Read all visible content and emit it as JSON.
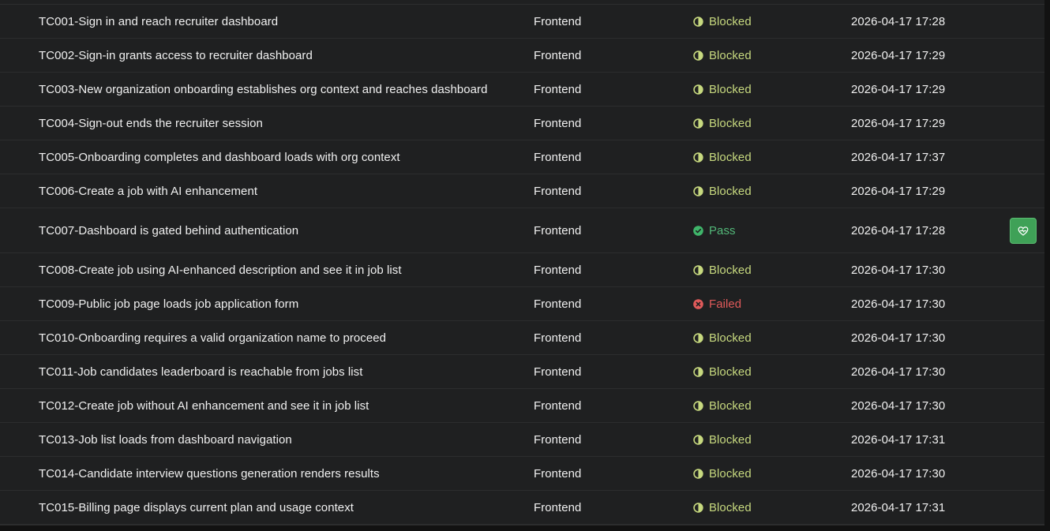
{
  "colors": {
    "background": "#1f2021",
    "blocked": "#c7d97f",
    "pass": "#53b879",
    "failed": "#e05a5a",
    "action_button": "#3fa157"
  },
  "rows": [
    {
      "name": "TC001-Sign in and reach recruiter dashboard",
      "type": "Frontend",
      "status": "Blocked",
      "status_icon": "half-circle-icon",
      "date": "2026-04-17 17:28"
    },
    {
      "name": "TC002-Sign-in grants access to recruiter dashboard",
      "type": "Frontend",
      "status": "Blocked",
      "status_icon": "half-circle-icon",
      "date": "2026-04-17 17:29"
    },
    {
      "name": "TC003-New organization onboarding establishes org context and reaches dashboard",
      "type": "Frontend",
      "status": "Blocked",
      "status_icon": "half-circle-icon",
      "date": "2026-04-17 17:29"
    },
    {
      "name": "TC004-Sign-out ends the recruiter session",
      "type": "Frontend",
      "status": "Blocked",
      "status_icon": "half-circle-icon",
      "date": "2026-04-17 17:29"
    },
    {
      "name": "TC005-Onboarding completes and dashboard loads with org context",
      "type": "Frontend",
      "status": "Blocked",
      "status_icon": "half-circle-icon",
      "date": "2026-04-17 17:37"
    },
    {
      "name": "TC006-Create a job with AI enhancement",
      "type": "Frontend",
      "status": "Blocked",
      "status_icon": "half-circle-icon",
      "date": "2026-04-17 17:29"
    },
    {
      "name": "TC007-Dashboard is gated behind authentication",
      "type": "Frontend",
      "status": "Pass",
      "status_icon": "check-circle-icon",
      "date": "2026-04-17 17:28",
      "action_icon": "heart-pulse-icon"
    },
    {
      "name": "TC008-Create job using AI-enhanced description and see it in job list",
      "type": "Frontend",
      "status": "Blocked",
      "status_icon": "half-circle-icon",
      "date": "2026-04-17 17:30"
    },
    {
      "name": "TC009-Public job page loads job application form",
      "type": "Frontend",
      "status": "Failed",
      "status_icon": "x-circle-icon",
      "date": "2026-04-17 17:30"
    },
    {
      "name": "TC010-Onboarding requires a valid organization name to proceed",
      "type": "Frontend",
      "status": "Blocked",
      "status_icon": "half-circle-icon",
      "date": "2026-04-17 17:30"
    },
    {
      "name": "TC011-Job candidates leaderboard is reachable from jobs list",
      "type": "Frontend",
      "status": "Blocked",
      "status_icon": "half-circle-icon",
      "date": "2026-04-17 17:30"
    },
    {
      "name": "TC012-Create job without AI enhancement and see it in job list",
      "type": "Frontend",
      "status": "Blocked",
      "status_icon": "half-circle-icon",
      "date": "2026-04-17 17:30"
    },
    {
      "name": "TC013-Job list loads from dashboard navigation",
      "type": "Frontend",
      "status": "Blocked",
      "status_icon": "half-circle-icon",
      "date": "2026-04-17 17:31"
    },
    {
      "name": "TC014-Candidate interview questions generation renders results",
      "type": "Frontend",
      "status": "Blocked",
      "status_icon": "half-circle-icon",
      "date": "2026-04-17 17:30"
    },
    {
      "name": "TC015-Billing page displays current plan and usage context",
      "type": "Frontend",
      "status": "Blocked",
      "status_icon": "half-circle-icon",
      "date": "2026-04-17 17:31"
    }
  ]
}
